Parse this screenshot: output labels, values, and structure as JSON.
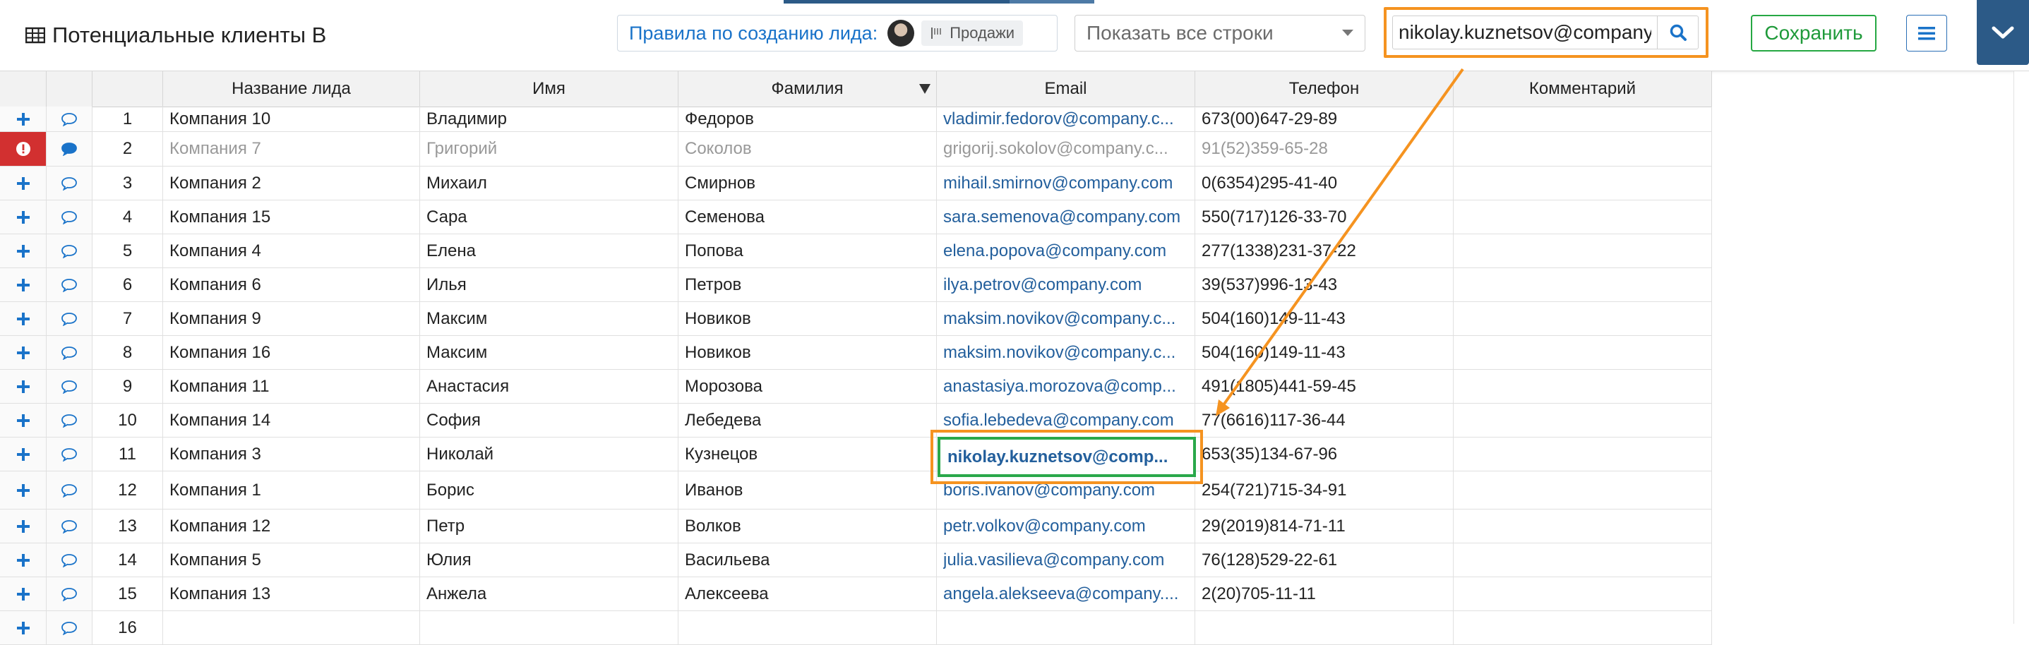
{
  "header": {
    "title": "Потенциальные клиенты B",
    "rules_label": "Правила по созданию лида:",
    "rules_tag": "Продажи",
    "show_rows": "Показать все строки",
    "search_value": "nikolay.kuznetsov@company.com",
    "save_label": "Сохранить"
  },
  "columns": {
    "lead_name": "Название лида",
    "first_name": "Имя",
    "last_name": "Фамилия",
    "email": "Email",
    "phone": "Телефон",
    "comment": "Комментарий"
  },
  "rows": [
    {
      "n": "1",
      "lead": "Компания 10",
      "first": "Владимир",
      "last": "Федоров",
      "email": "vladimir.fedorov@company.c...",
      "phone": "673(00)647-29-89"
    },
    {
      "n": "2",
      "lead": "Компания 7",
      "first": "Григорий",
      "last": "Соколов",
      "email": "grigorij.sokolov@company.c...",
      "phone": "91(52)359-65-28"
    },
    {
      "n": "3",
      "lead": "Компания 2",
      "first": "Михаил",
      "last": "Смирнов",
      "email": "mihail.smirnov@company.com",
      "phone": "0(6354)295-41-40"
    },
    {
      "n": "4",
      "lead": "Компания 15",
      "first": "Сара",
      "last": "Семенова",
      "email": "sara.semenova@company.com",
      "phone": "550(717)126-33-70"
    },
    {
      "n": "5",
      "lead": "Компания 4",
      "first": "Елена",
      "last": "Попова",
      "email": "elena.popova@company.com",
      "phone": "277(1338)231-37-22"
    },
    {
      "n": "6",
      "lead": "Компания 6",
      "first": "Илья",
      "last": "Петров",
      "email": "ilya.petrov@company.com",
      "phone": "39(537)996-13-43"
    },
    {
      "n": "7",
      "lead": "Компания 9",
      "first": "Максим",
      "last": "Новиков",
      "email": "maksim.novikov@company.c...",
      "phone": "504(160)149-11-43"
    },
    {
      "n": "8",
      "lead": "Компания 16",
      "first": "Максим",
      "last": "Новиков",
      "email": "maksim.novikov@company.c...",
      "phone": "504(160)149-11-43"
    },
    {
      "n": "9",
      "lead": "Компания 11",
      "first": "Анастасия",
      "last": "Морозова",
      "email": "anastasiya.morozova@comp...",
      "phone": "491(1805)441-59-45"
    },
    {
      "n": "10",
      "lead": "Компания 14",
      "first": "София",
      "last": "Лебедева",
      "email": "sofia.lebedeva@company.com",
      "phone": "77(6616)117-36-44"
    },
    {
      "n": "11",
      "lead": "Компания 3",
      "first": "Николай",
      "last": "Кузнецов",
      "email": "nikolay.kuznetsov@comp...",
      "phone": "653(35)134-67-96"
    },
    {
      "n": "12",
      "lead": "Компания 1",
      "first": "Борис",
      "last": "Иванов",
      "email": "boris.ivanov@company.com",
      "phone": "254(721)715-34-91"
    },
    {
      "n": "13",
      "lead": "Компания 12",
      "first": "Петр",
      "last": "Волков",
      "email": "petr.volkov@company.com",
      "phone": "29(2019)814-71-11"
    },
    {
      "n": "14",
      "lead": "Компания 5",
      "first": "Юлия",
      "last": "Васильева",
      "email": "julia.vasilieva@company.com",
      "phone": "76(128)529-22-61"
    },
    {
      "n": "15",
      "lead": "Компания 13",
      "first": "Анжела",
      "last": "Алексеева",
      "email": "angela.alekseeva@company....",
      "phone": "2(20)705-11-11"
    },
    {
      "n": "16",
      "lead": "",
      "first": "",
      "last": "",
      "email": "",
      "phone": ""
    }
  ],
  "icons": [
    "table-icon",
    "flag-icon",
    "search-icon",
    "menu-icon",
    "chevron-down-icon",
    "plus-icon",
    "comment-icon",
    "error-icon"
  ],
  "colors": {
    "accent": "#1a73c9",
    "save": "#26a843",
    "highlight": "#f59320",
    "error": "#d23030",
    "topbar_blue": "#2c5a87"
  }
}
